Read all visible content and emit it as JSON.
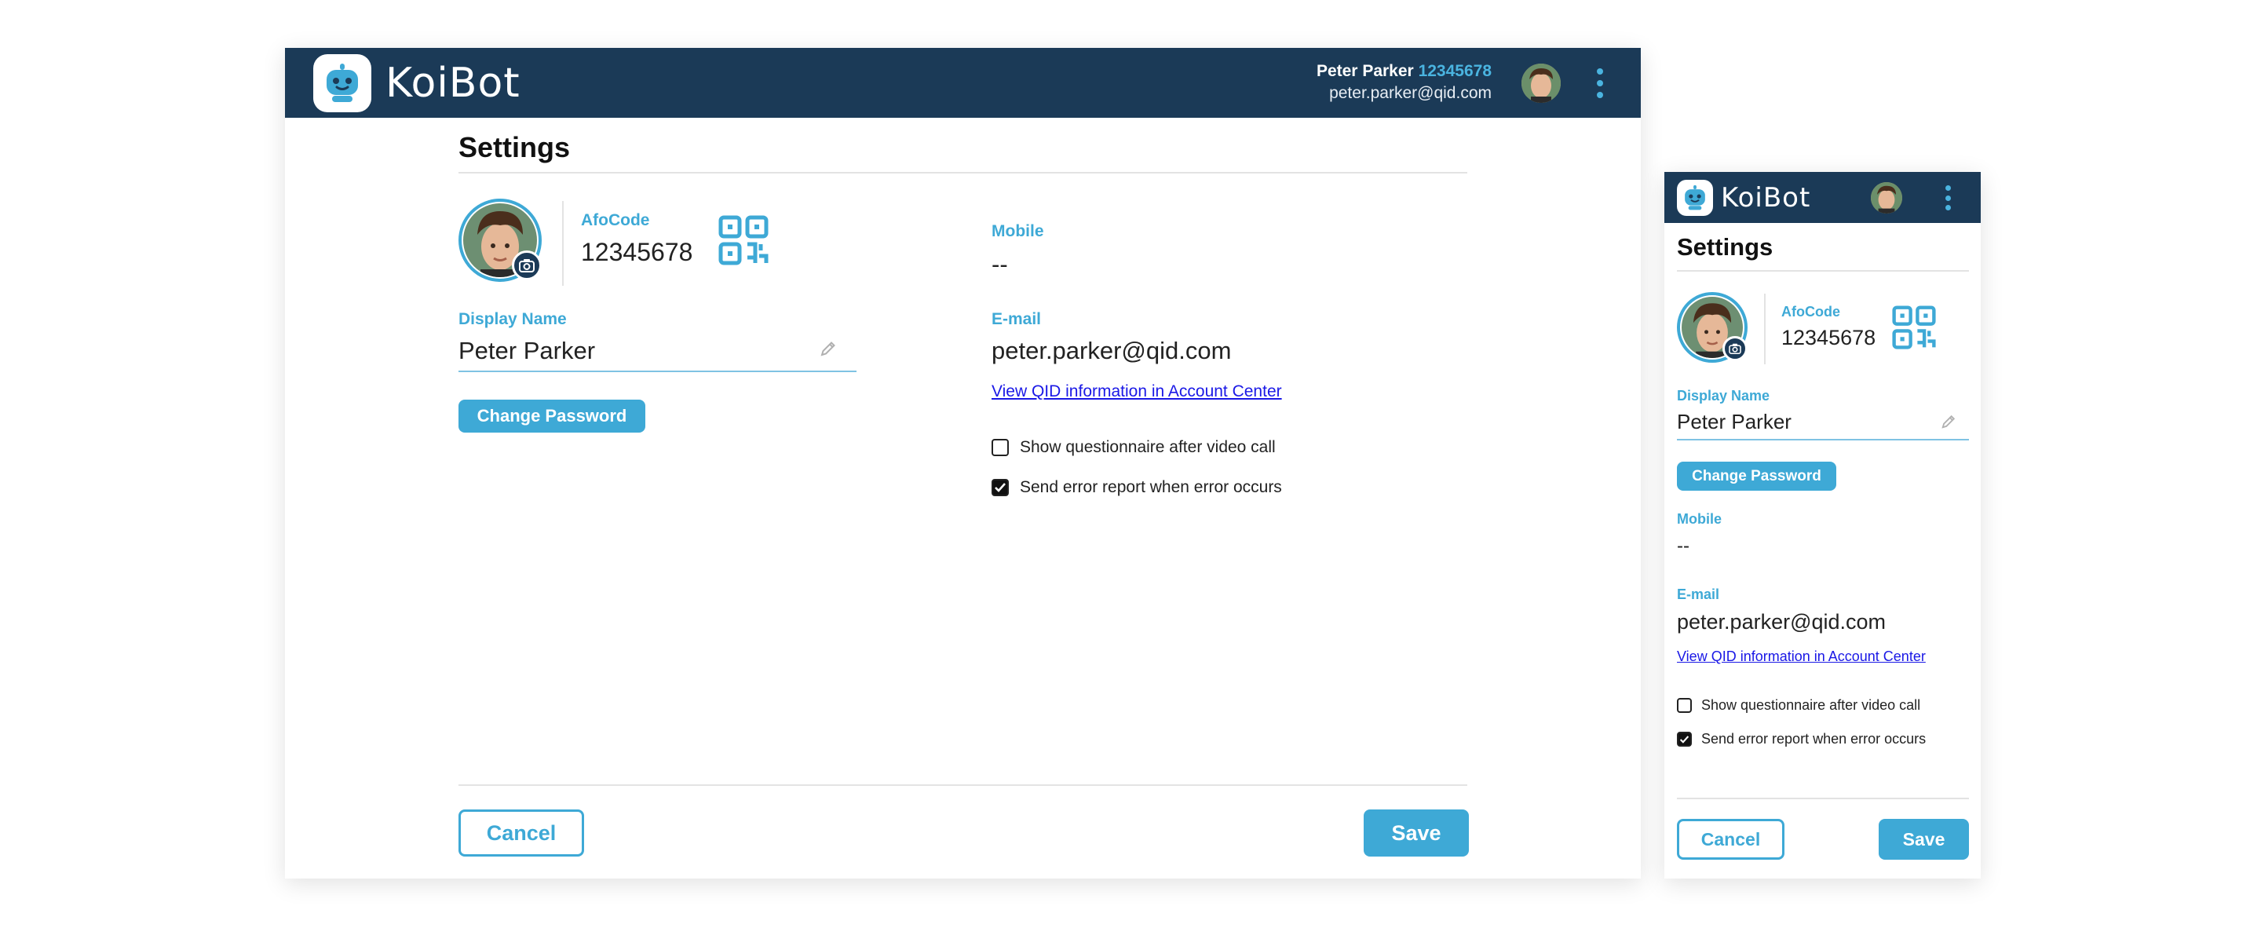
{
  "app": {
    "name": "KoiBot"
  },
  "header": {
    "user_name": "Peter Parker",
    "user_code": "12345678",
    "user_email": "peter.parker@qid.com"
  },
  "settings": {
    "title": "Settings",
    "afocode_label": "AfoCode",
    "afocode_value": "12345678",
    "display_name_label": "Display Name",
    "display_name_value": "Peter Parker",
    "change_password_label": "Change Password",
    "mobile_label": "Mobile",
    "mobile_value": "--",
    "email_label": "E-mail",
    "email_value": "peter.parker@qid.com",
    "account_center_link": "View QID information in Account Center",
    "checkboxes": [
      {
        "label": "Show questionnaire after video call",
        "checked": false
      },
      {
        "label": "Send error report when error occurs",
        "checked": true
      }
    ],
    "cancel_label": "Cancel",
    "save_label": "Save"
  },
  "colors": {
    "header_bg": "#1b3a57",
    "accent": "#3ea9d6",
    "link": "#1a18e6"
  },
  "icons": [
    "koibot-logo-icon",
    "kebab-menu-icon",
    "camera-icon",
    "qr-code-icon",
    "pencil-icon",
    "checkmark-icon"
  ]
}
